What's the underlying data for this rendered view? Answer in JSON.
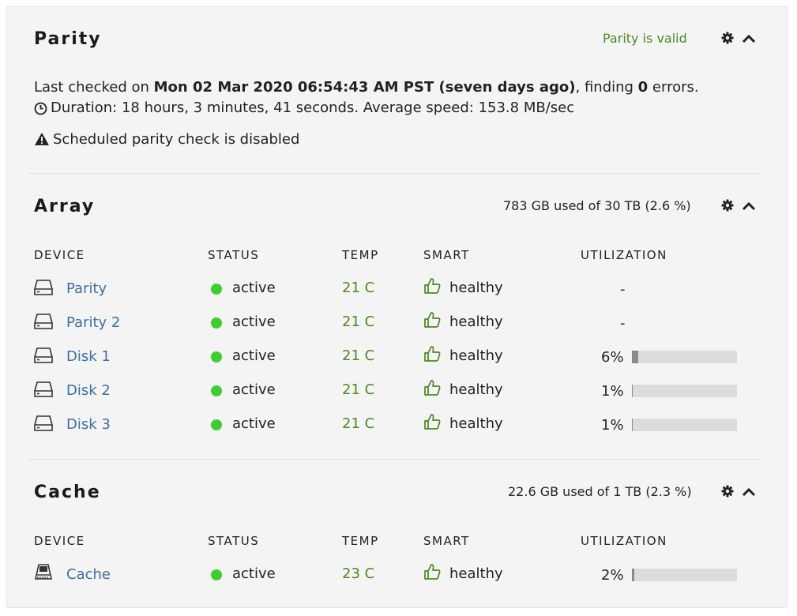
{
  "parity": {
    "title": "Parity",
    "status": "Parity is valid",
    "last_checked_prefix": "Last checked on ",
    "last_checked_date": "Mon 02 Mar 2020 06:54:43 AM PST (seven days ago)",
    "finding_prefix": ", finding ",
    "error_count": "0",
    "finding_suffix": " errors.",
    "duration": "Duration: 18 hours, 3 minutes, 41 seconds. Average speed: 153.8 MB/sec",
    "schedule_warning": "Scheduled parity check is disabled"
  },
  "array": {
    "title": "Array",
    "usage": "783 GB used of 30 TB (2.6 %)",
    "headers": {
      "device": "DEVICE",
      "status": "STATUS",
      "temp": "TEMP",
      "smart": "SMART",
      "utilization": "UTILIZATION"
    },
    "rows": [
      {
        "name": "Parity",
        "status": "active",
        "temp": "21 C",
        "smart": "healthy",
        "util": "-"
      },
      {
        "name": "Parity 2",
        "status": "active",
        "temp": "21 C",
        "smart": "healthy",
        "util": "-"
      },
      {
        "name": "Disk 1",
        "status": "active",
        "temp": "21 C",
        "smart": "healthy",
        "util": "6%",
        "fraction": 0.06
      },
      {
        "name": "Disk 2",
        "status": "active",
        "temp": "21 C",
        "smart": "healthy",
        "util": "1%",
        "fraction": 0.01
      },
      {
        "name": "Disk 3",
        "status": "active",
        "temp": "21 C",
        "smart": "healthy",
        "util": "1%",
        "fraction": 0.01
      }
    ]
  },
  "cache": {
    "title": "Cache",
    "usage": "22.6 GB used of 1 TB (2.3 %)",
    "headers": {
      "device": "DEVICE",
      "status": "STATUS",
      "temp": "TEMP",
      "smart": "SMART",
      "utilization": "UTILIZATION"
    },
    "rows": [
      {
        "name": "Cache",
        "status": "active",
        "temp": "23 C",
        "smart": "healthy",
        "util": "2%",
        "fraction": 0.02
      }
    ]
  },
  "icons": {
    "settings": "gear-icon",
    "collapse": "chevron-up-icon",
    "clock": "clock-icon",
    "warning": "warning-icon",
    "disk": "hard-drive-icon",
    "ssd": "ssd-icon",
    "smart": "thumbs-up-icon",
    "status": "status-dot"
  },
  "colors": {
    "accent_green": "#4a8a1c",
    "status_green": "#3ccf2c",
    "link_blue": "#3d6fa8",
    "bar_bg": "#dcdcdc",
    "bar_fill": "#8a8a8a"
  }
}
